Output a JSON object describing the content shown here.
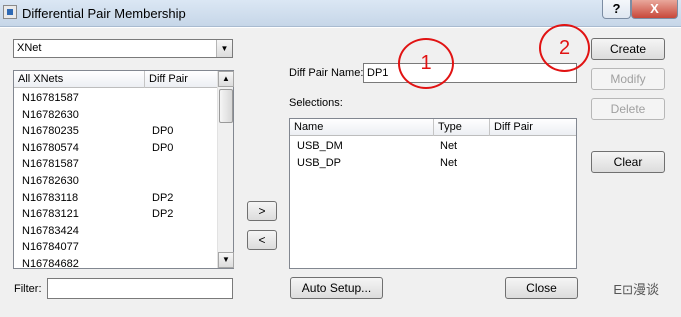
{
  "window": {
    "title": "Differential Pair Membership",
    "help_label": "?",
    "close_label": "X"
  },
  "net_filter": {
    "selected": "XNet",
    "dropdown_glyph": "▼"
  },
  "xnet_list": {
    "headers": [
      "All XNets",
      "Diff Pair"
    ],
    "rows": [
      {
        "net": "N16781587",
        "pair": ""
      },
      {
        "net": "N16782630",
        "pair": ""
      },
      {
        "net": "N16780235",
        "pair": "DP0"
      },
      {
        "net": "N16780574",
        "pair": "DP0"
      },
      {
        "net": "N16781587",
        "pair": ""
      },
      {
        "net": "N16782630",
        "pair": ""
      },
      {
        "net": "N16783118",
        "pair": "DP2"
      },
      {
        "net": "N16783121",
        "pair": "DP2"
      },
      {
        "net": "N16783424",
        "pair": ""
      },
      {
        "net": "N16784077",
        "pair": ""
      },
      {
        "net": "N16784682",
        "pair": ""
      }
    ],
    "scroll_up": "▲",
    "scroll_down": "▼",
    "scroll_position": 0.0
  },
  "filter": {
    "label": "Filter:",
    "value": ""
  },
  "move_buttons": {
    "add": ">",
    "remove": "<"
  },
  "diff_pair": {
    "label": "Diff Pair Name:",
    "value": "DP1"
  },
  "selections": {
    "label": "Selections:",
    "headers": [
      "Name",
      "Type",
      "Diff Pair"
    ],
    "rows": [
      {
        "name": "USB_DM",
        "type": "Net",
        "pair": ""
      },
      {
        "name": "USB_DP",
        "type": "Net",
        "pair": ""
      }
    ]
  },
  "actions": {
    "create": "Create",
    "modify": "Modify",
    "delete": "Delete",
    "clear": "Clear",
    "auto_setup": "Auto Setup...",
    "close": "Close"
  },
  "annotations": {
    "one": "1",
    "two": "2"
  },
  "watermark": "E⊡漫谈",
  "colors": {
    "callout": "#e11313",
    "close_button": "#c8483a"
  }
}
